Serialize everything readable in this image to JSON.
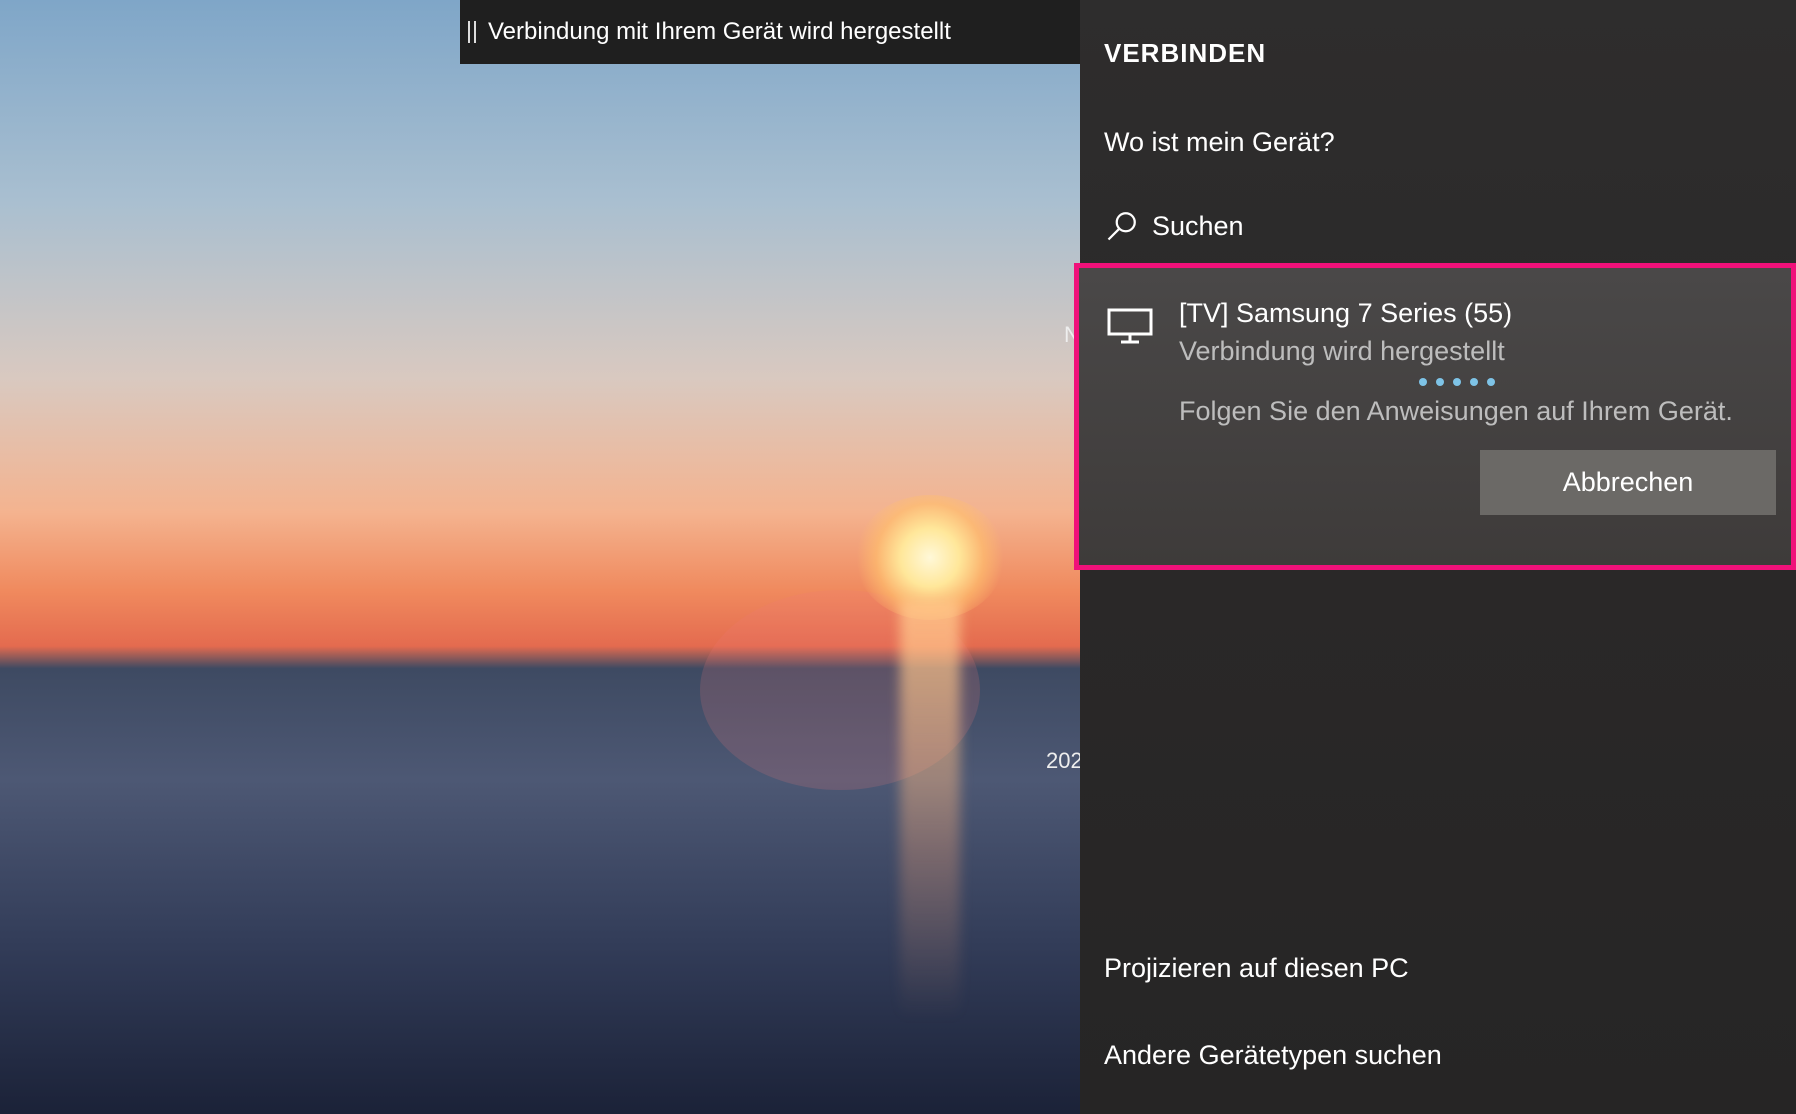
{
  "desktop": {
    "stray_text_1": "N",
    "stray_text_2": "202"
  },
  "topbar": {
    "title": "Verbindung mit Ihrem Gerät wird hergestellt",
    "settings_icon": "gear-icon",
    "pin_icon": "pin-icon",
    "expand_icon": "chevron-right-icon"
  },
  "panel": {
    "title": "VERBINDEN",
    "where_link": "Wo ist mein Gerät?",
    "search_label": "Suchen",
    "device": {
      "name": "[TV] Samsung 7 Series (55)",
      "status": "Verbindung wird hergestellt",
      "instruction": "Folgen Sie den Anweisungen auf Ihrem Gerät.",
      "cancel_label": "Abbrechen",
      "icon": "monitor-icon"
    },
    "project_link": "Projizieren auf diesen PC",
    "other_link": "Andere Gerätetypen suchen"
  },
  "colors": {
    "highlight": "#f0117a",
    "progress": "#7ec3e6"
  }
}
